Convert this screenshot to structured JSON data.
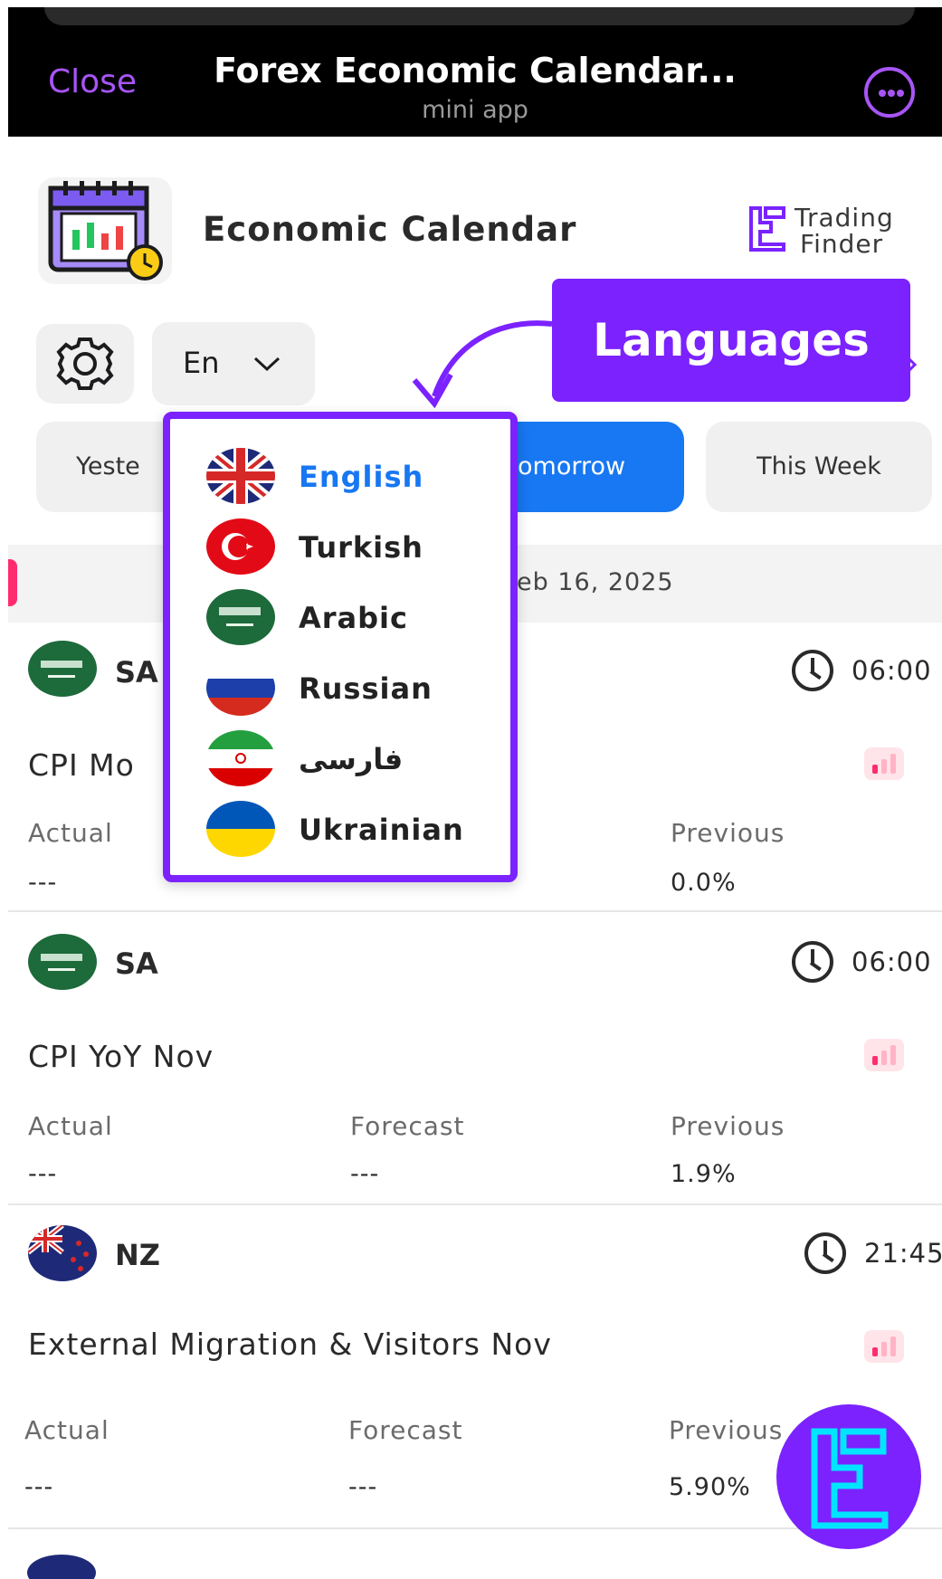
{
  "topbar": {
    "close_label": "Close",
    "title": "Forex Economic Calendar...",
    "subtitle": "mini app",
    "more_icon": "more-dots-icon"
  },
  "header": {
    "app_title": "Economic Calendar",
    "brand_line1": "Trading",
    "brand_line2": "Finder"
  },
  "controls": {
    "language_code": "En",
    "callout_label": "Languages"
  },
  "tabs": {
    "yesterday": "Yeste",
    "tomorrow": "omorrow",
    "this_week": "This Week"
  },
  "date_label": "eb 16, 2025",
  "languages": [
    {
      "label": "English",
      "flag": "uk-flag",
      "active": true
    },
    {
      "label": "Turkish",
      "flag": "turkey-flag"
    },
    {
      "label": "Arabic",
      "flag": "saudi-flag"
    },
    {
      "label": "Russian",
      "flag": "russia-flag"
    },
    {
      "label": "فارسی",
      "flag": "iran-flag"
    },
    {
      "label": "Ukrainian",
      "flag": "ukraine-flag"
    }
  ],
  "columns": {
    "actual": "Actual",
    "forecast": "Forecast",
    "previous": "Previous"
  },
  "events": [
    {
      "country": "SA",
      "time": "06:00",
      "name": "CPI Mo",
      "actual": "---",
      "forecast": "",
      "previous": "0.0%"
    },
    {
      "country": "SA",
      "time": "06:00",
      "name": "CPI YoY Nov",
      "actual": "---",
      "forecast": "---",
      "previous": "1.9%"
    },
    {
      "country": "NZ",
      "time": "21:45",
      "name": "External Migration & Visitors Nov",
      "actual": "---",
      "forecast": "---",
      "previous": "5.90%"
    }
  ],
  "colors": {
    "accent": "#7b22ff",
    "active_tab": "#1877f2",
    "impact": "#ff2d6f"
  }
}
